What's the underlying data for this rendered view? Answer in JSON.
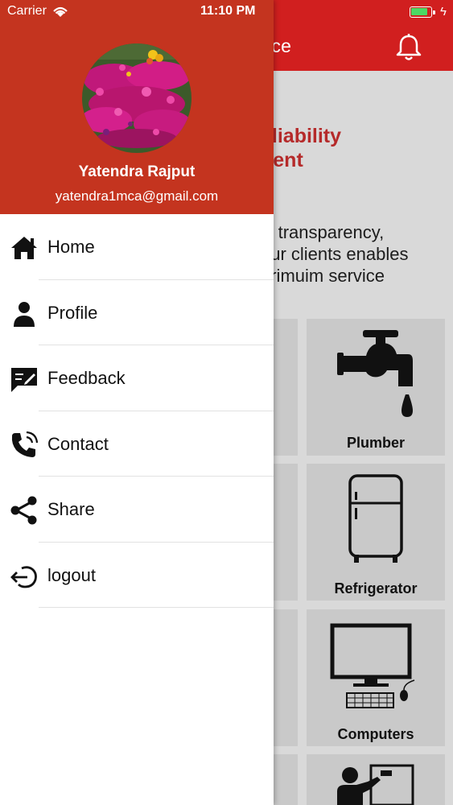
{
  "status_bar": {
    "carrier": "Carrier",
    "time": "11:10 PM"
  },
  "app": {
    "title_fragment": "rice",
    "hero_red_lines": [
      "eliability",
      "nent"
    ],
    "hero_text_lines": [
      "y, transparency,",
      "our clients enables",
      "primuim service"
    ],
    "tiles": [
      {
        "label": "Plumber",
        "icon": "faucet-icon"
      },
      {
        "label": "Refrigerator",
        "icon": "refrigerator-icon"
      },
      {
        "label": "Computers",
        "icon": "computer-icon"
      }
    ],
    "colors": {
      "header": "#d11f1f",
      "accent_text": "#b52a2a"
    }
  },
  "drawer": {
    "user_name": "Yatendra Rajput",
    "user_email": "yatendra1mca@gmail.com",
    "colors": {
      "header": "#c4341f"
    },
    "items": [
      {
        "label": "Home",
        "icon": "home-icon"
      },
      {
        "label": "Profile",
        "icon": "person-icon"
      },
      {
        "label": "Feedback",
        "icon": "feedback-icon"
      },
      {
        "label": "Contact",
        "icon": "phone-icon"
      },
      {
        "label": "Share",
        "icon": "share-icon"
      },
      {
        "label": "logout",
        "icon": "logout-icon"
      }
    ]
  }
}
